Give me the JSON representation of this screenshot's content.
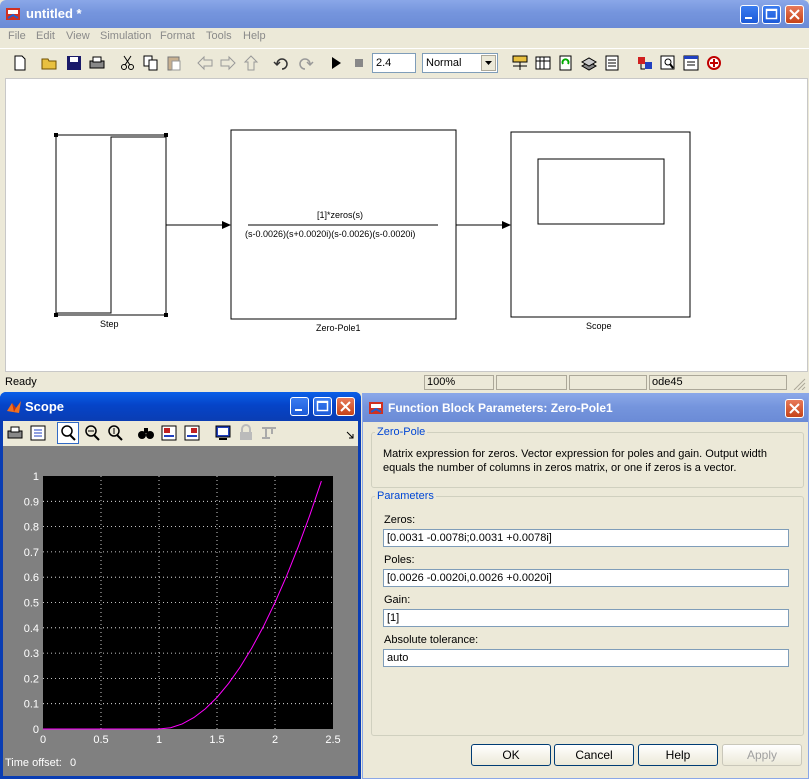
{
  "simulink": {
    "title": "untitled *",
    "menu": [
      "File",
      "Edit",
      "View",
      "Simulation",
      "Format",
      "Tools",
      "Help"
    ],
    "stop_time": "2.4",
    "sim_mode": "Normal",
    "blocks": {
      "step": "Step",
      "zeropole": "Zero-Pole1",
      "numerator": "[1]*zeros(s)",
      "denominator": "(s-0.0026)(s+0.0020i)(s-0.0026)(s-0.0020i)",
      "scope": "Scope"
    },
    "status": {
      "ready": "Ready",
      "zoom": "100%",
      "solver": "ode45"
    }
  },
  "scope": {
    "title": "Scope",
    "time_offset_label": "Time offset:",
    "time_offset_value": "0"
  },
  "dialog": {
    "title": "Function Block Parameters: Zero-Pole1",
    "section_label": "Zero-Pole",
    "description": "Matrix expression for zeros.  Vector expression for poles and gain.  Output width equals the number of columns in zeros matrix, or one if zeros is a vector.",
    "params_label": "Parameters",
    "zeros_label": "Zeros:",
    "zeros_value": "[0.0031 -0.0078i;0.0031 +0.0078i]",
    "poles_label": "Poles:",
    "poles_value": "[0.0026 -0.0020i,0.0026 +0.0020i]",
    "gain_label": "Gain:",
    "gain_value": "[1]",
    "abstol_label": "Absolute tolerance:",
    "abstol_value": "auto",
    "ok": "OK",
    "cancel": "Cancel",
    "help": "Help",
    "apply": "Apply"
  },
  "colors": {
    "xp_blue": "#0a5fe8",
    "plot_bg": "#000000",
    "trace": "#ff00ff",
    "grid": "#ffffff"
  },
  "chart_data": {
    "type": "line",
    "x": [
      0,
      0.5,
      1.0,
      1.1,
      1.2,
      1.3,
      1.4,
      1.5,
      1.6,
      1.7,
      1.8,
      1.9,
      2.0,
      2.1,
      2.2,
      2.3,
      2.4
    ],
    "y": [
      0,
      0,
      0,
      0.005,
      0.02,
      0.045,
      0.08,
      0.125,
      0.18,
      0.245,
      0.32,
      0.405,
      0.5,
      0.605,
      0.72,
      0.845,
      0.98
    ],
    "xlim": [
      0,
      2.5
    ],
    "ylim": [
      0,
      1
    ],
    "xticks": [
      "0",
      "0.5",
      "1",
      "1.5",
      "2",
      "2.5"
    ],
    "yticks": [
      "0",
      "0.1",
      "0.2",
      "0.3",
      "0.4",
      "0.5",
      "0.6",
      "0.7",
      "0.8",
      "0.9",
      "1"
    ],
    "grid": true
  }
}
